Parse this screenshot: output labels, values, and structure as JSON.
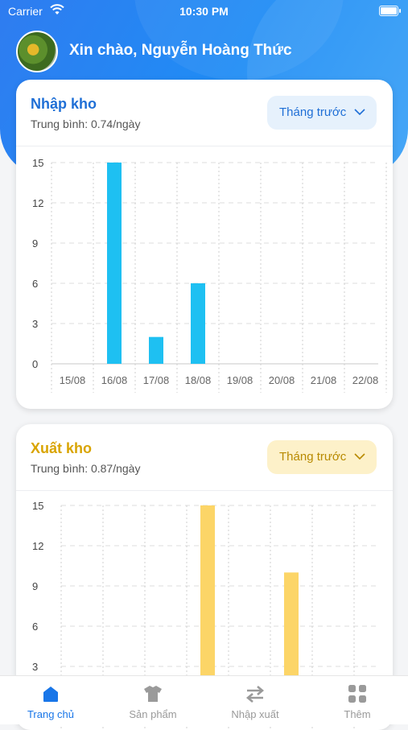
{
  "status_bar": {
    "carrier": "Carrier",
    "time": "10:30 PM"
  },
  "header": {
    "greeting": "Xin chào, Nguyễn Hoàng Thức"
  },
  "cards": [
    {
      "title": "Nhập kho",
      "subtitle": "Trung bình: 0.74/ngày",
      "dropdown_label": "Tháng trước",
      "accent": "#1f6fd6",
      "bar_color": "#1ec0f2"
    },
    {
      "title": "Xuất kho",
      "subtitle": "Trung bình: 0.87/ngày",
      "dropdown_label": "Tháng trước",
      "accent": "#d9a400",
      "bar_color": "#fcd567"
    }
  ],
  "chart_data": [
    {
      "type": "bar",
      "categories": [
        "15/08",
        "16/08",
        "17/08",
        "18/08",
        "19/08",
        "20/08",
        "21/08",
        "22/08"
      ],
      "values": [
        0,
        15,
        2,
        6,
        0,
        0,
        0,
        0
      ],
      "xlabel": "",
      "ylabel": "",
      "yticks": [
        0,
        3,
        6,
        9,
        12,
        15
      ],
      "ylim": [
        0,
        15
      ],
      "grid": true
    },
    {
      "type": "bar",
      "categories": [
        "",
        "",
        "",
        "",
        "",
        "",
        "",
        ""
      ],
      "values": [
        0,
        0,
        0,
        15,
        0,
        10,
        0,
        0
      ],
      "xlabel": "",
      "ylabel": "",
      "yticks": [
        3,
        6,
        9,
        12,
        15
      ],
      "ylim": [
        0,
        15
      ],
      "grid": true
    }
  ],
  "tabbar": {
    "items": [
      {
        "label": "Trang chủ",
        "icon": "home-icon",
        "active": true
      },
      {
        "label": "Sản phẩm",
        "icon": "shirt-icon",
        "active": false
      },
      {
        "label": "Nhập xuất",
        "icon": "swap-arrows-icon",
        "active": false
      },
      {
        "label": "Thêm",
        "icon": "grid-icon",
        "active": false
      }
    ],
    "active_color": "#1976e8",
    "inactive_color": "#9a9a9a"
  }
}
